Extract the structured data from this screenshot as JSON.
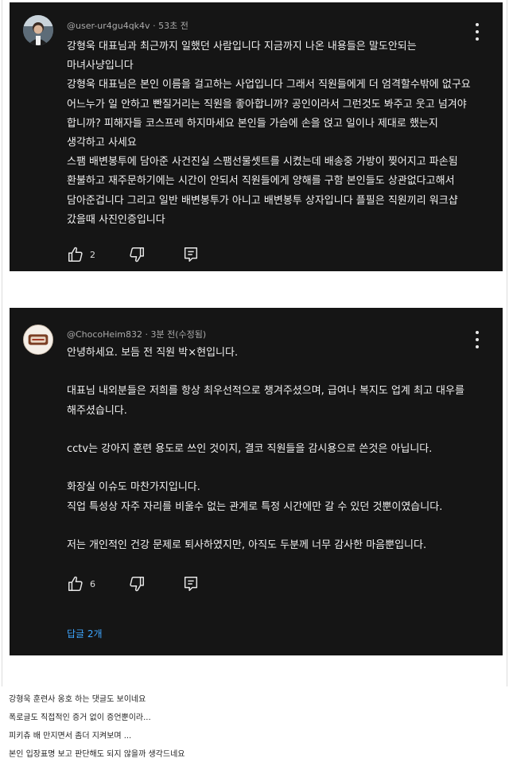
{
  "comments": [
    {
      "author": "@user-ur4gu4qk4v",
      "time": "53초 전",
      "body": "강형욱 대표님과 최근까지 일했던 사람입니다 지금까지 나온 내용들은 말도안되는\n마녀사냥입니다\n강형욱 대표님은 본인 이름을 걸고하는 사업입니다 그래서 직원들에게 더 엄격할수밖에 없구요\n어느누가 일 안하고 빤질거리는 직원을 좋아합니까? 공인이라서 그런것도 봐주고 웃고 넘겨야\n합니까? 피해자들 코스프레 하지마세요 본인들 가슴에 손을 얹고 일이나 제대로 했는지\n생각하고 사세요\n스팸 배변봉투에 담아준 사건진실 스팸선물셋트를 시켰는데 배송중 가방이 찢어지고 파손됨\n환불하고 재주문하기에는 시간이 안되서 직원들에게 양해를 구함 본인들도 상관없다고해서\n담아준겁니다 그리고 일반 배변봉투가 아니고 배변봉투 상자입니다 플필은 직원끼리 워크샵\n갔을때 사진인증입니다",
      "likes": "2",
      "icons": {
        "like": "thumbs-up-icon",
        "dislike": "thumbs-down-icon",
        "reply": "reply-icon",
        "menu": "more-vert-icon"
      }
    },
    {
      "author": "@ChocoHeim832",
      "time": "3분 전(수정됨)",
      "body": "안녕하세요. 보듬 전 직원 박×현입니다.\n\n대표님 내외분들은 저희를 항상 최우선적으로 챙겨주셨으며, 급여나 복지도 업계 최고 대우를\n해주셨습니다.\n\ncctv는 강아지 훈련 용도로 쓰인 것이지, 결코 직원들을 감시용으로 쓴것은 아닙니다.\n\n화장실 이슈도 마찬가지입니다.\n직업 특성상 자주 자리를 비울수 없는 관계로 특정 시간에만 갈 수 있던 것뿐이였습니다.\n\n저는 개인적인 건강 문제로 퇴사하였지만, 아직도 두분께 너무 감사한 마음뿐입니다.",
      "likes": "6",
      "replies": "답글 2개",
      "icons": {
        "like": "thumbs-up-icon",
        "dislike": "thumbs-down-icon",
        "reply": "reply-icon",
        "menu": "more-vert-icon"
      }
    }
  ],
  "captions": [
    "강형욱 훈련사 옹호 하는 댓글도 보이네요",
    "폭로글도 직접적인 증거 없이 증언뿐이라...",
    "피키츄 배 만지면서  좀더 지켜보며 ...",
    "본인 입장표명 보고 판단해도 되지 않을까 생각드네요"
  ],
  "colors": {
    "card_bg": "#151515",
    "text": "#f1f1f1",
    "meta": "#aaaaaa",
    "link": "#3ea6ff"
  }
}
